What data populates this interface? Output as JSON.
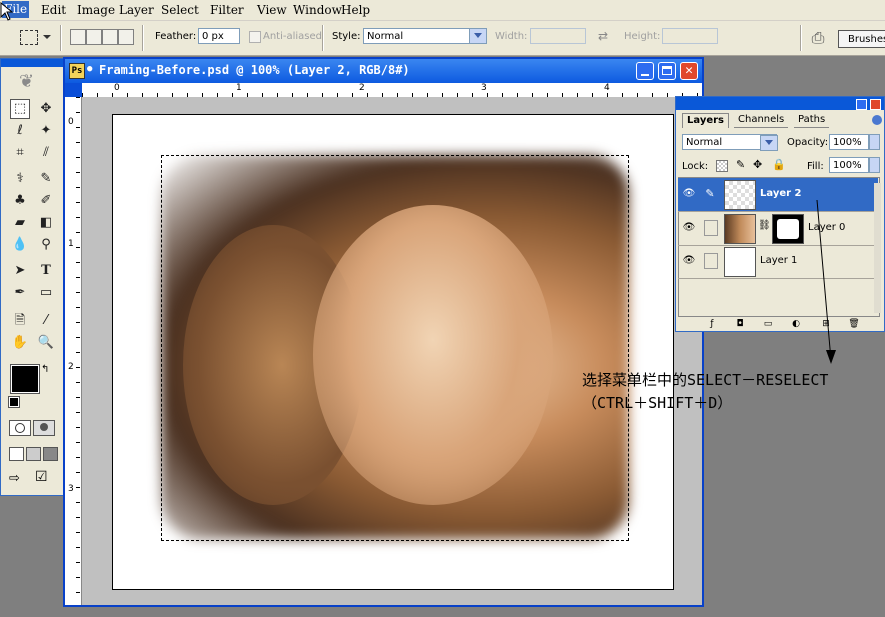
{
  "menubar": {
    "items": [
      "File",
      "Edit",
      "Image",
      "Layer",
      "Select",
      "Filter",
      "View",
      "Window",
      "Help"
    ]
  },
  "options": {
    "feather_label": "Feather:",
    "feather_value": "0 px",
    "anti_aliased_label": "Anti-aliased",
    "style_label": "Style:",
    "style_value": "Normal",
    "width_label": "Width:",
    "height_label": "Height:",
    "brushes_label": "Brushes"
  },
  "document": {
    "title": "Framing-Before.psd @ 100% (Layer 2, RGB/8#)",
    "ruler_top_ticks": [
      "0",
      "1",
      "2",
      "3",
      "4"
    ],
    "ruler_left_ticks": [
      "0",
      "1",
      "2",
      "3"
    ]
  },
  "layers_panel": {
    "tabs": [
      "Layers",
      "Channels",
      "Paths"
    ],
    "blend_mode": "Normal",
    "opacity_label": "Opacity:",
    "opacity_value": "100%",
    "lock_label": "Lock:",
    "fill_label": "Fill:",
    "fill_value": "100%",
    "layers": [
      {
        "name": "Layer 2",
        "selected": true
      },
      {
        "name": "Layer 0",
        "selected": false
      },
      {
        "name": "Layer 1",
        "selected": false
      }
    ]
  },
  "annotation": {
    "line1": "选择菜单栏中的SELECT－RESELECT",
    "line2": "（CTRL＋SHIFT＋D）"
  },
  "colors": {
    "accent": "#316ac5",
    "titlebar": "#0a58d8",
    "chrome": "#ece9d8"
  }
}
